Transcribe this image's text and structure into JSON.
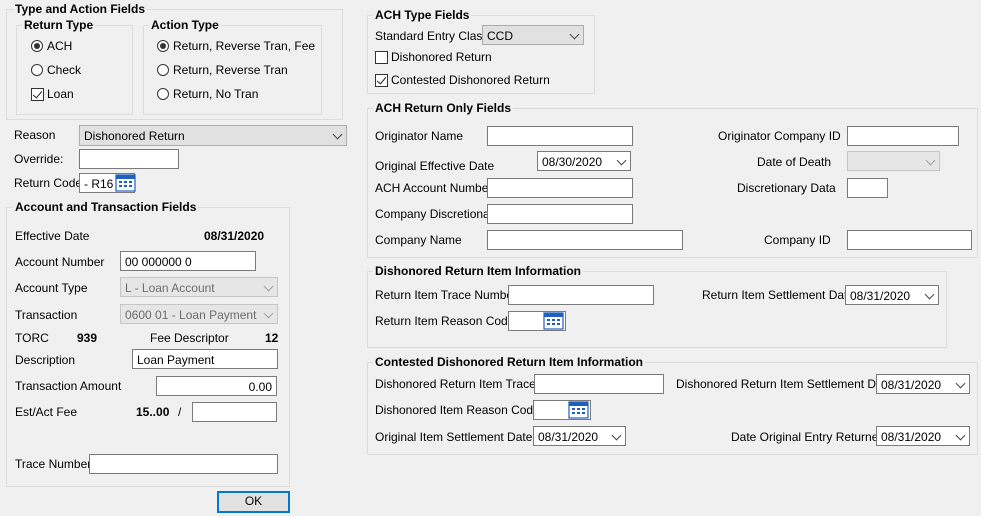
{
  "type_action": {
    "title": "Type and Action Fields",
    "return_type": {
      "title": "Return Type",
      "options": [
        "ACH",
        "Check",
        "Loan"
      ]
    },
    "action_type": {
      "title": "Action Type",
      "options": [
        "Return, Reverse Tran, Fee",
        "Return, Reverse Tran",
        "Return, No Tran"
      ]
    }
  },
  "reason": {
    "label": "Reason",
    "value": "Dishonored Return"
  },
  "override": {
    "label": "Override:",
    "value": ""
  },
  "return_code": {
    "label": "Return Code",
    "value": "- R16"
  },
  "account": {
    "title": "Account and Transaction Fields",
    "effective_date_label": "Effective Date",
    "effective_date": "08/31/2020",
    "account_number_label": "Account Number",
    "account_number": "00 000000 0",
    "account_type_label": "Account Type",
    "account_type": "L - Loan Account",
    "transaction_label": "Transaction",
    "transaction": "0600 01 - Loan Payment",
    "torc_label": "TORC",
    "torc": "939",
    "fee_descriptor_label": "Fee Descriptor",
    "fee_descriptor": "12",
    "description_label": "Description",
    "description": "Loan Payment",
    "amount_label": "Transaction Amount",
    "amount": "0.00",
    "fee_label": "Est/Act Fee",
    "fee_value": "15..00",
    "fee_sep": "/",
    "fee_actual": "",
    "trace_label": "Trace Number",
    "trace": ""
  },
  "ach_type": {
    "title": "ACH Type Fields",
    "sec_label": "Standard Entry Class",
    "sec_value": "CCD",
    "dishonored_label": "Dishonored Return",
    "contested_label": "Contested Dishonored Return"
  },
  "ach_return": {
    "title": "ACH Return Only Fields",
    "originator_name_label": "Originator Name",
    "originator_company_id_label": "Originator Company ID",
    "original_effective_date_label": "Original Effective Date",
    "original_effective_date": "08/30/2020",
    "date_of_death_label": "Date of Death",
    "date_of_death": "",
    "ach_account_number_label": "ACH Account Number",
    "discretionary_data_label": "Discretionary Data",
    "company_discretionary_label": "Company Discretionary",
    "company_name_label": "Company Name",
    "company_id_label": "Company ID"
  },
  "dishonored": {
    "title": "Dishonored Return Item Information",
    "trace_label": "Return Item Trace Number",
    "settlement_label": "Return Item Settlement Date",
    "settlement_date": "08/31/2020",
    "reason_label": "Return Item Reason Code"
  },
  "contested": {
    "title": "Contested Dishonored Return Item Information",
    "trace_label": "Dishonored Return Item Trace #",
    "settlement_label": "Dishonored Return Item Settlement Date",
    "settlement_date": "08/31/2020",
    "reason_label": "Dishonored Item Reason Code",
    "orig_settlement_label": "Original Item Settlement Date",
    "orig_settlement_date": "08/31/2020",
    "date_returned_label": "Date Original Entry Returned",
    "date_returned": "08/31/2020"
  },
  "ok_button": "OK",
  "icons": {
    "lookup": "calendar-grid-icon",
    "dropdown": "chevron-down-icon"
  },
  "colors": {
    "accent": "#0078d7",
    "lookup_icon": "#1f5fbf"
  }
}
